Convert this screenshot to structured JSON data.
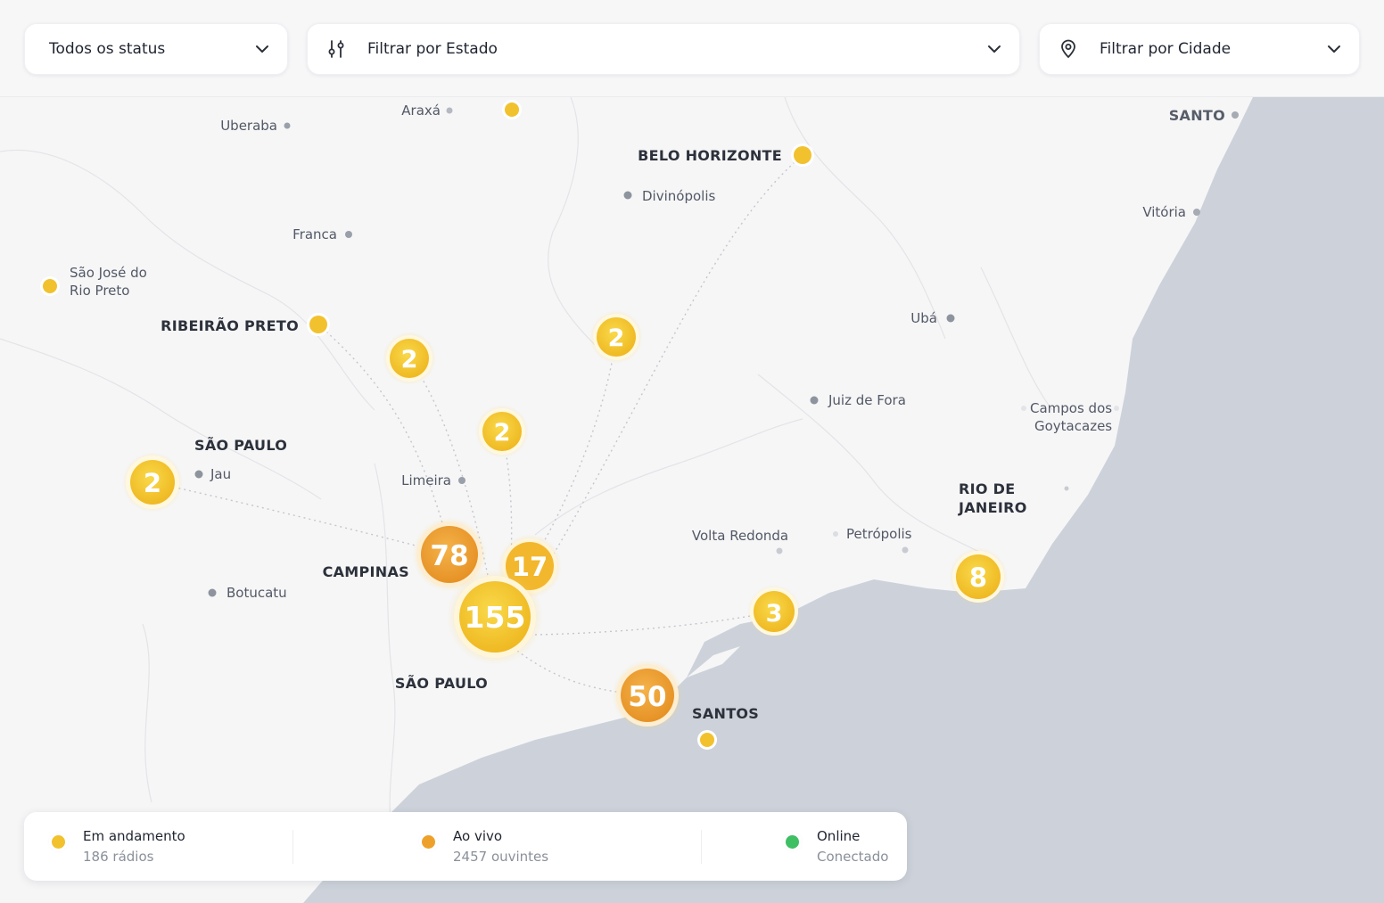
{
  "filters": {
    "status": {
      "value": "Todos os status",
      "icon": "chevron-down-icon"
    },
    "estado": {
      "value": "Filtrar por Estado",
      "icon": "filter-sliders-icon"
    },
    "cidade": {
      "value": "Filtrar por Cidade",
      "icon": "map-pin-icon"
    }
  },
  "map": {
    "sea_color": "#cdd2da",
    "land_color": "#f6f6f7",
    "city_labels": [
      "Uberaba",
      "Araxá",
      "Divinópolis",
      "Franca",
      "São José do",
      "Rio Preto",
      "Ubá",
      "Juiz de Fora",
      "Campos dos",
      "Goytacazes",
      "Jau",
      "Limeira",
      "Volta Redonda",
      "Petrópolis",
      "Botucatu",
      "Vitória",
      "SANTO"
    ],
    "major_labels": [
      "BELO HORIZONTE",
      "RIBEIRÃO PRETO",
      "SÃO PAULO",
      "CAMPINAS",
      "SÃO PAULO",
      "SANTOS",
      "RIO DE",
      "JANEIRO"
    ],
    "clusters": [
      {
        "count": "2",
        "status": "em-andamento"
      },
      {
        "count": "2",
        "status": "em-andamento"
      },
      {
        "count": "2",
        "status": "em-andamento"
      },
      {
        "count": "2",
        "status": "em-andamento"
      },
      {
        "count": "78",
        "status": "ao-vivo"
      },
      {
        "count": "17",
        "status": "em-andamento"
      },
      {
        "count": "155",
        "status": "em-andamento"
      },
      {
        "count": "3",
        "status": "em-andamento"
      },
      {
        "count": "50",
        "status": "ao-vivo"
      },
      {
        "count": "8",
        "status": "em-andamento"
      }
    ]
  },
  "legend": [
    {
      "title": "Em andamento",
      "subtitle": "186 rádios",
      "color": "#f2c12e"
    },
    {
      "title": "Ao vivo",
      "subtitle": "2457 ouvintes",
      "color": "#eea12a"
    },
    {
      "title": "Online",
      "subtitle": "Conectado",
      "color": "#3fbf63"
    }
  ]
}
